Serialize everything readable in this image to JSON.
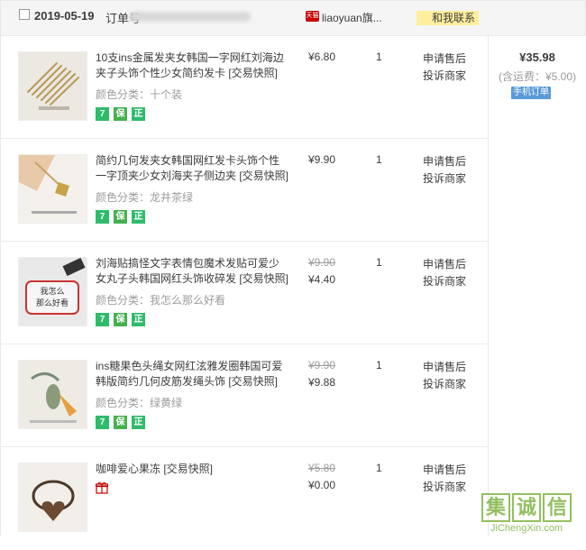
{
  "order": {
    "date": "2019-05-19",
    "order_label": "订单号",
    "shop_name": "liaoyuan旗...",
    "tmall_tag": "天猫",
    "contact_label": "和我联系",
    "total": "¥35.98",
    "shipping": "(含运费：¥5.00)",
    "mobile_tag": "手机订单"
  },
  "items": [
    {
      "title": "10支ins金属发夹女韩国一字网红刘海边夹子头饰个性少女简约发卡 [交易快照]",
      "sku": "颜色分类：十个装",
      "price": "¥6.80",
      "qty": "1",
      "after_sale": "申请售后",
      "complain": "投诉商家",
      "badges": [
        "7",
        "保",
        "正"
      ]
    },
    {
      "title": "简约几何发夹女韩国网红发卡头饰个性一字顶夹少女刘海夹子侧边夹 [交易快照]",
      "sku": "颜色分类：龙井茶绿",
      "price": "¥9.90",
      "qty": "1",
      "after_sale": "申请售后",
      "complain": "投诉商家",
      "badges": [
        "7",
        "保",
        "正"
      ]
    },
    {
      "title": "刘海贴搞怪文字表情包魔术发贴可爱少女丸子头韩国网红头饰收碎发 [交易快照]",
      "sku": "颜色分类：我怎么那么好看",
      "original_price": "¥9.90",
      "price": "¥4.40",
      "qty": "1",
      "after_sale": "申请售后",
      "complain": "投诉商家",
      "badges": [
        "7",
        "保",
        "正"
      ]
    },
    {
      "title": "ins糖果色头绳女网红泫雅发圈韩国可爱韩版简约几何皮筋发绳头饰 [交易快照]",
      "sku": "颜色分类：绿黄绿",
      "original_price": "¥9.90",
      "price": "¥9.88",
      "qty": "1",
      "after_sale": "申请售后",
      "complain": "投诉商家",
      "badges": [
        "7",
        "保",
        "正"
      ]
    },
    {
      "title": "咖啡爱心果冻 [交易快照]",
      "original_price": "¥5.80",
      "price": "¥0.00",
      "qty": "1",
      "after_sale": "申请售后",
      "complain": "投诉商家"
    }
  ],
  "watermark": {
    "chars": [
      "集",
      "诚",
      "信"
    ],
    "url": "JiChengXin.com"
  }
}
